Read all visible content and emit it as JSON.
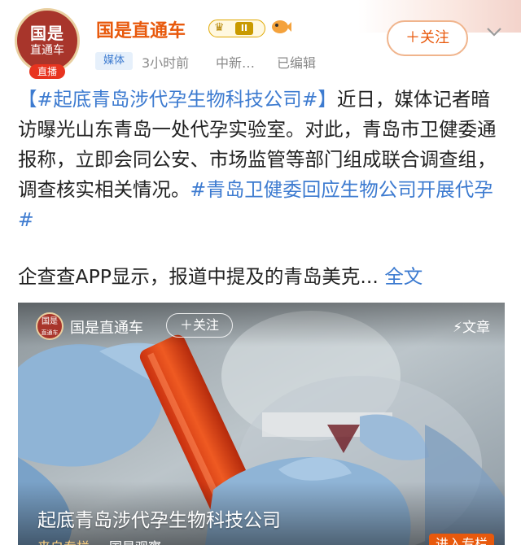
{
  "header": {
    "avatar": {
      "line1": "国是",
      "line2": "直通车"
    },
    "live_badge": "直播",
    "user_name": "国是直通车",
    "level_badge": {
      "level": "II",
      "icon": "crown-icon"
    },
    "media_tag": "媒体",
    "time": "3小时前",
    "source": "中新…",
    "edited": "已编辑",
    "follow_label": "＋关注",
    "colors": {
      "name": "#e8590c",
      "tag_link": "#3d7bd0",
      "follow_border": "#f0b48c"
    }
  },
  "post": {
    "hashtag1": "【#起底青岛涉代孕生物科技公司#】",
    "text1": "近日，媒体记者暗访曝光山东青岛一处代孕实验室。对此，青岛市卫健委通报称，立即会同公安、市场监管等部门组成联合调查组，调查核实相关情况。",
    "hashtag2": "#青岛卫健委回应生物公司开展代孕#",
    "text2": "企查查APP显示，报道中提及的青岛美克...",
    "more": "全文"
  },
  "card": {
    "avatar": {
      "line1": "国是",
      "line2": "直通车"
    },
    "name": "国是直通车",
    "follow_label": "＋关注",
    "type_label": "文章",
    "type_icon": "lightning-icon",
    "title": "起底青岛涉代孕生物科技公司",
    "footer_left": "来自专栏",
    "footer_right": "国是观察",
    "enter_label": "进入专栏"
  }
}
